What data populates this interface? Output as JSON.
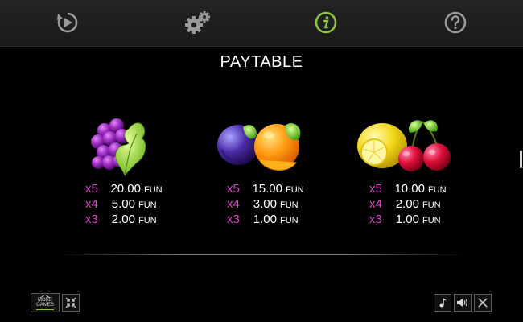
{
  "topbar": {
    "icons": [
      "replay-icon",
      "settings-gears-icon",
      "info-icon",
      "help-icon"
    ],
    "active_color": "#8dc63f",
    "icon_color": "#9a9a9a"
  },
  "title": "PAYTABLE",
  "symbols": [
    {
      "name": "grapes",
      "pays": [
        {
          "mult": "x5",
          "amount": "20.00",
          "currency": "FUN"
        },
        {
          "mult": "x4",
          "amount": "5.00",
          "currency": "FUN"
        },
        {
          "mult": "x3",
          "amount": "2.00",
          "currency": "FUN"
        }
      ]
    },
    {
      "name": "plum-orange",
      "pays": [
        {
          "mult": "x5",
          "amount": "15.00",
          "currency": "FUN"
        },
        {
          "mult": "x4",
          "amount": "3.00",
          "currency": "FUN"
        },
        {
          "mult": "x3",
          "amount": "1.00",
          "currency": "FUN"
        }
      ]
    },
    {
      "name": "lemon-cherries",
      "pays": [
        {
          "mult": "x5",
          "amount": "10.00",
          "currency": "FUN"
        },
        {
          "mult": "x4",
          "amount": "2.00",
          "currency": "FUN"
        },
        {
          "mult": "x3",
          "amount": "1.00",
          "currency": "FUN"
        }
      ]
    }
  ],
  "bottom": {
    "more_games_line1": "MORE",
    "more_games_line2": "GAMES"
  },
  "colors": {
    "multiplier": "#e040c8",
    "accent_green": "#8dc63f"
  }
}
